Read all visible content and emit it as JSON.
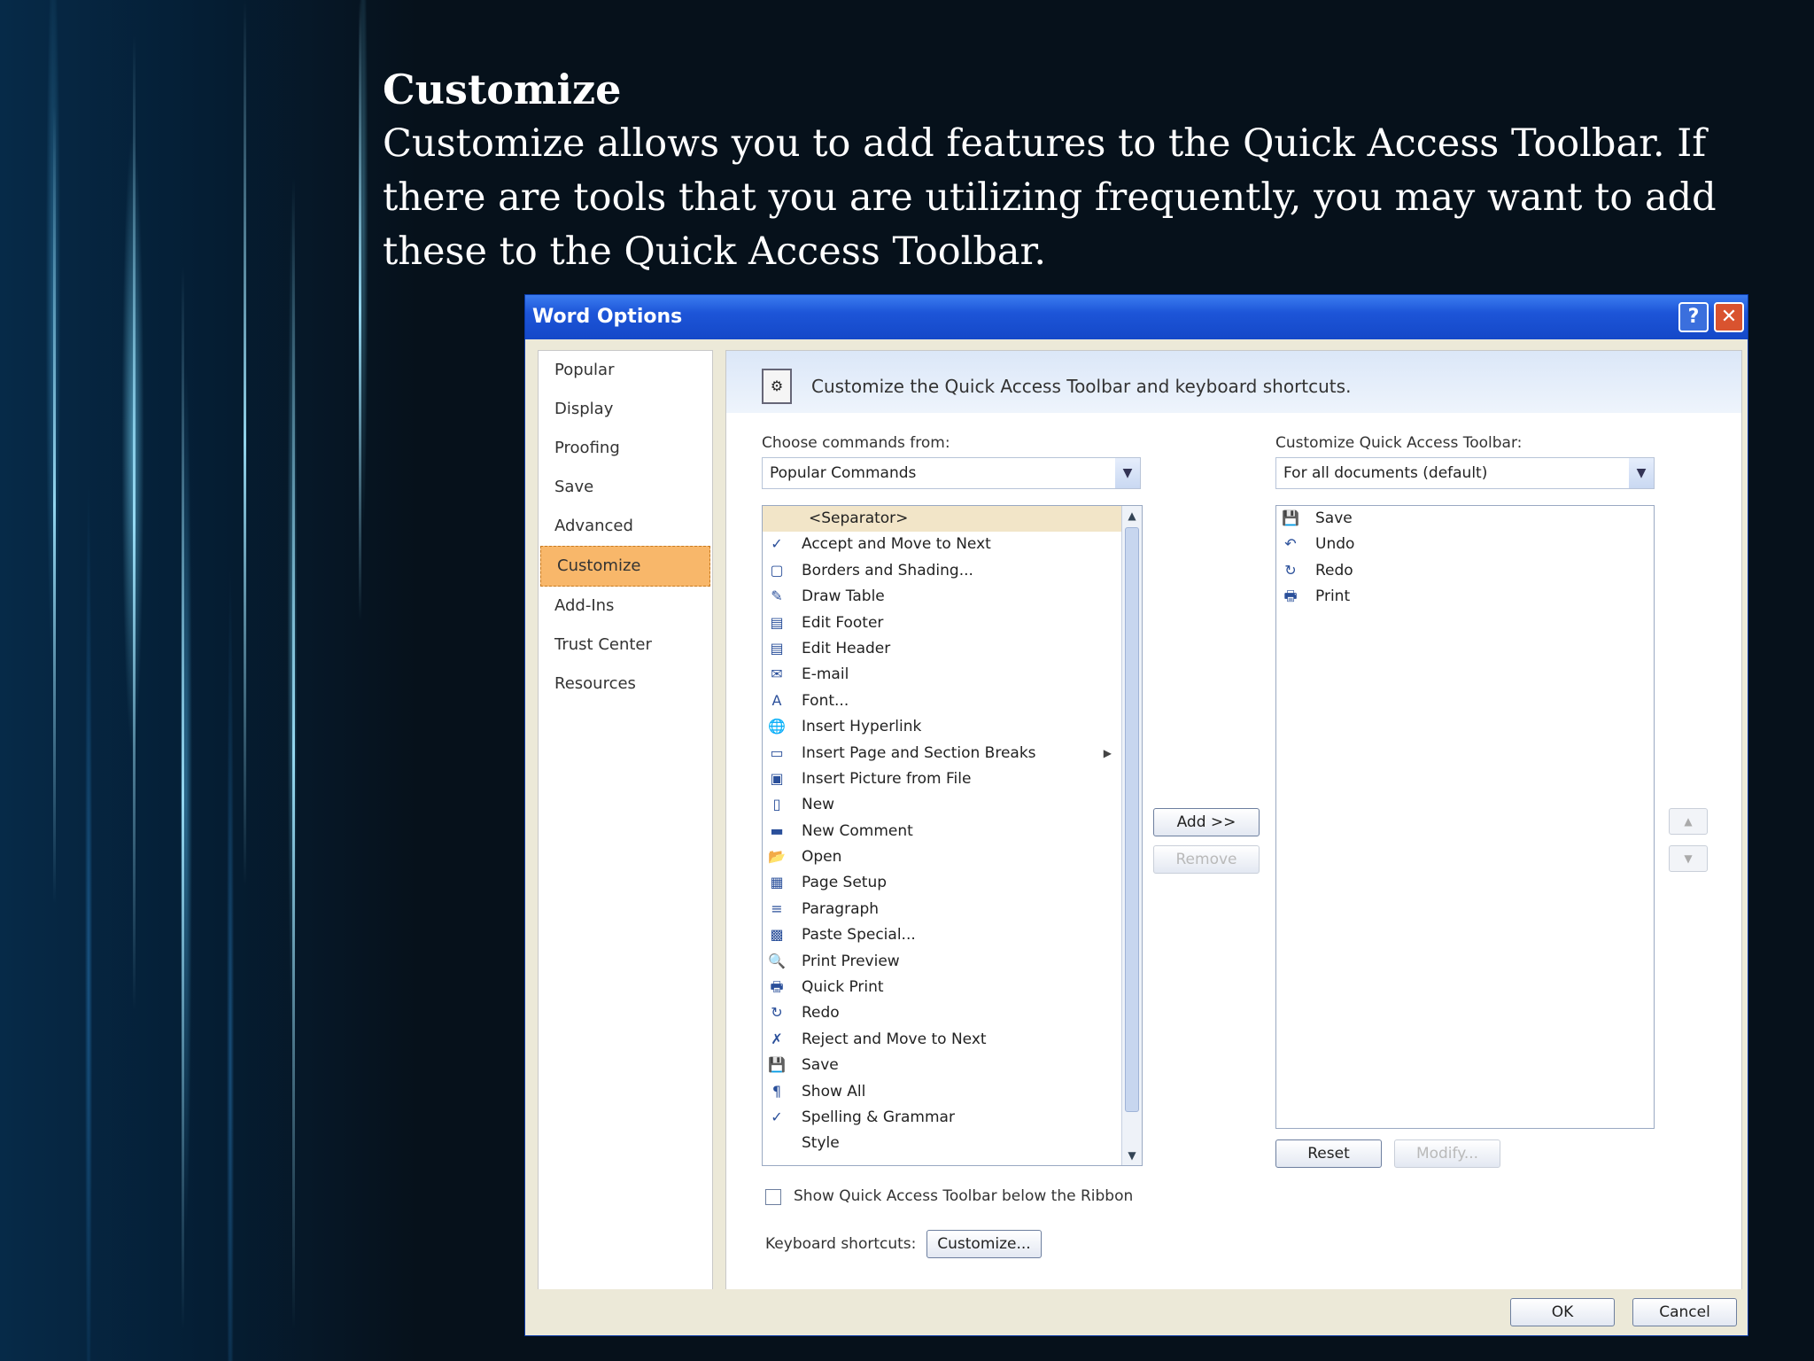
{
  "slide": {
    "title": "Customize",
    "body": "Customize allows you to add features to the Quick Access Toolbar. If there are tools that you are utilizing frequently, you may want to add these to the Quick Access Toolbar."
  },
  "dialog": {
    "title": "Word Options",
    "help_glyph": "?",
    "close_glyph": "✕",
    "nav": [
      "Popular",
      "Display",
      "Proofing",
      "Save",
      "Advanced",
      "Customize",
      "Add-Ins",
      "Trust Center",
      "Resources"
    ],
    "selected_nav": "Customize",
    "header": "Customize the Quick Access Toolbar and keyboard shortcuts.",
    "choose_label": "Choose commands from:",
    "choose_value": "Popular Commands",
    "qat_label": "Customize Quick Access Toolbar:",
    "qat_value": "For all documents (default)",
    "commands": [
      {
        "label": "<Separator>",
        "icon": "separator"
      },
      {
        "label": "Accept and Move to Next",
        "icon": "accept-icon",
        "glyph": "✓"
      },
      {
        "label": "Borders and Shading...",
        "icon": "borders-icon",
        "glyph": "▢"
      },
      {
        "label": "Draw Table",
        "icon": "draw-table-icon",
        "glyph": "✎"
      },
      {
        "label": "Edit Footer",
        "icon": "footer-icon",
        "glyph": "▤"
      },
      {
        "label": "Edit Header",
        "icon": "header-icon",
        "glyph": "▤"
      },
      {
        "label": "E-mail",
        "icon": "email-icon",
        "glyph": "✉"
      },
      {
        "label": "Font...",
        "icon": "font-icon",
        "glyph": "A"
      },
      {
        "label": "Insert Hyperlink",
        "icon": "hyperlink-icon",
        "glyph": "🌐"
      },
      {
        "label": "Insert Page and Section Breaks",
        "icon": "page-break-icon",
        "glyph": "▭",
        "submenu": true
      },
      {
        "label": "Insert Picture from File",
        "icon": "picture-icon",
        "glyph": "▣"
      },
      {
        "label": "New",
        "icon": "new-doc-icon",
        "glyph": "▯"
      },
      {
        "label": "New Comment",
        "icon": "comment-icon",
        "glyph": "▬"
      },
      {
        "label": "Open",
        "icon": "open-folder-icon",
        "glyph": "📂"
      },
      {
        "label": "Page Setup",
        "icon": "page-setup-icon",
        "glyph": "▦"
      },
      {
        "label": "Paragraph",
        "icon": "paragraph-settings-icon",
        "glyph": "≡"
      },
      {
        "label": "Paste Special...",
        "icon": "paste-icon",
        "glyph": "▩"
      },
      {
        "label": "Print Preview",
        "icon": "print-preview-icon",
        "glyph": "🔍"
      },
      {
        "label": "Quick Print",
        "icon": "quick-print-icon",
        "glyph": "🖶"
      },
      {
        "label": "Redo",
        "icon": "redo-icon",
        "glyph": "↻"
      },
      {
        "label": "Reject and Move to Next",
        "icon": "reject-icon",
        "glyph": "✗"
      },
      {
        "label": "Save",
        "icon": "save-icon",
        "glyph": "💾"
      },
      {
        "label": "Show All",
        "icon": "pilcrow-icon",
        "glyph": "¶"
      },
      {
        "label": "Spelling & Grammar",
        "icon": "spelling-icon",
        "glyph": "✓"
      },
      {
        "label": "Style",
        "icon": "style-icon",
        "glyph": ""
      }
    ],
    "qat_items": [
      {
        "label": "Save",
        "icon": "save-icon",
        "glyph": "💾"
      },
      {
        "label": "Undo",
        "icon": "undo-icon",
        "glyph": "↶"
      },
      {
        "label": "Redo",
        "icon": "redo-icon",
        "glyph": "↻"
      },
      {
        "label": "Print",
        "icon": "print-icon",
        "glyph": "🖶"
      }
    ],
    "add_button": "Add >>",
    "remove_button": "Remove",
    "reset_button": "Reset",
    "modify_button": "Modify...",
    "show_below_label": "Show Quick Access Toolbar below the Ribbon",
    "keyboard_label": "Keyboard shortcuts:",
    "customize_button": "Customize...",
    "ok_button": "OK",
    "cancel_button": "Cancel"
  }
}
